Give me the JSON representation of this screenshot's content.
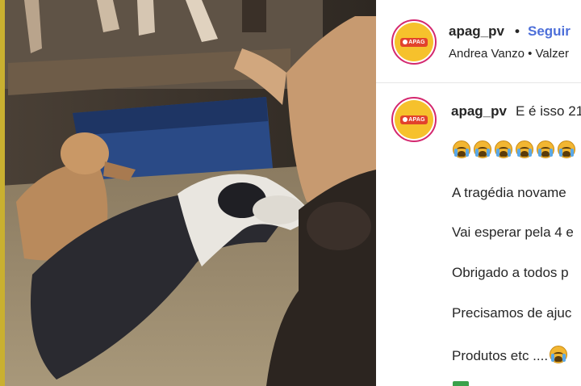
{
  "post": {
    "username": "apag_pv",
    "separator": "•",
    "follow_label": "Seguir",
    "subline": "Andrea Vanzo • Valzer",
    "avatar_logo_text": "APAG"
  },
  "caption": {
    "username": "apag_pv",
    "first_text": "E é isso 21",
    "emoji_count": 6,
    "emoji_name": "crying-face-emoji",
    "lines": [
      "A tragédia novame",
      "Vai esperar pela 4 e",
      "Obrigado a todos p",
      "Precisamos de ajuc",
      "Produtos etc ...."
    ]
  },
  "colors": {
    "follow": "#4d6fd9",
    "text": "#262626",
    "avatar_ring": "#d4286f",
    "avatar_fill": "#f6c12c",
    "logo_red": "#e2422c"
  },
  "media": {
    "description_icon": "video-frame-dogs-flood"
  }
}
